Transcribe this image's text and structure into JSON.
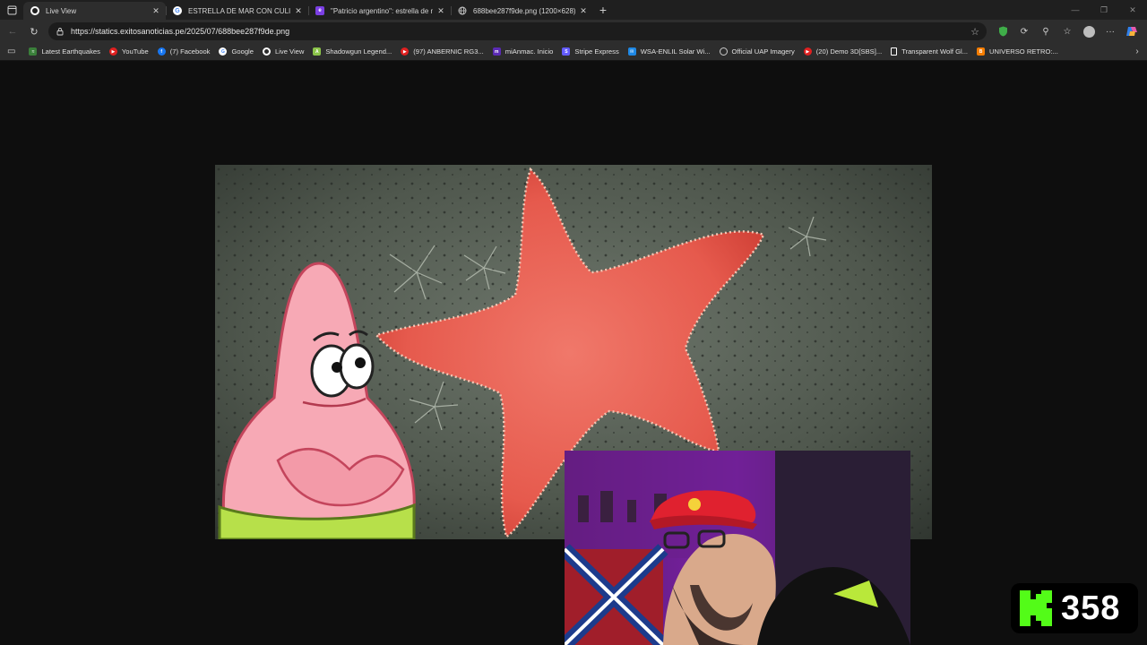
{
  "browser": {
    "tabs": [
      {
        "title": "Live View",
        "favicon": "github-icon",
        "active": true
      },
      {
        "title": "ESTRELLA DE MAR CON CULITO",
        "favicon": "google-icon",
        "active": false
      },
      {
        "title": "\"Patricio argentino\": estrella de m",
        "favicon": "site-icon",
        "active": false
      },
      {
        "title": "688bee287f9de.png (1200×628)",
        "favicon": "globe-icon",
        "active": false
      }
    ],
    "address": {
      "url": "https://statics.exitosanoticias.pe/2025/07/688bee287f9de.png"
    },
    "bookmarks": [
      {
        "label": "Latest Earthquakes",
        "icon": "usgs-icon",
        "color": "#3a7f3a"
      },
      {
        "label": "YouTube",
        "icon": "youtube-icon",
        "color": "#e02020"
      },
      {
        "label": "(7) Facebook",
        "icon": "facebook-icon",
        "color": "#1877f2"
      },
      {
        "label": "Google",
        "icon": "google-icon",
        "color": "#ffffff"
      },
      {
        "label": "Live View",
        "icon": "github-icon",
        "color": "#ffffff"
      },
      {
        "label": "Shadowgun Legend...",
        "icon": "android-icon",
        "color": "#8bc34a"
      },
      {
        "label": "(97) ANBERNIC RG3...",
        "icon": "youtube-icon",
        "color": "#e02020"
      },
      {
        "label": "miAnmac. Inicio",
        "icon": "anmac-icon",
        "color": "#5b2bb5"
      },
      {
        "label": "Stripe Express",
        "icon": "stripe-icon",
        "color": "#635bff"
      },
      {
        "label": "WSA-ENLIL Solar Wi...",
        "icon": "noaa-icon",
        "color": "#1e88e5"
      },
      {
        "label": "Official UAP Imagery",
        "icon": "ring-icon",
        "color": "#cccccc"
      },
      {
        "label": "(20) Demo 3D[SBS]...",
        "icon": "youtube-icon",
        "color": "#e02020"
      },
      {
        "label": "Transparent Wolf Gl...",
        "icon": "doc-icon",
        "color": "#ffffff"
      },
      {
        "label": "UNIVERSO RETRO:...",
        "icon": "blogger-icon",
        "color": "#f57d00"
      }
    ]
  },
  "content": {
    "image_description_icon": "starfish-image",
    "webcam_icon": "streamer-webcam"
  },
  "overlay": {
    "kick_count": "358",
    "kick_color": "#53fc18"
  }
}
